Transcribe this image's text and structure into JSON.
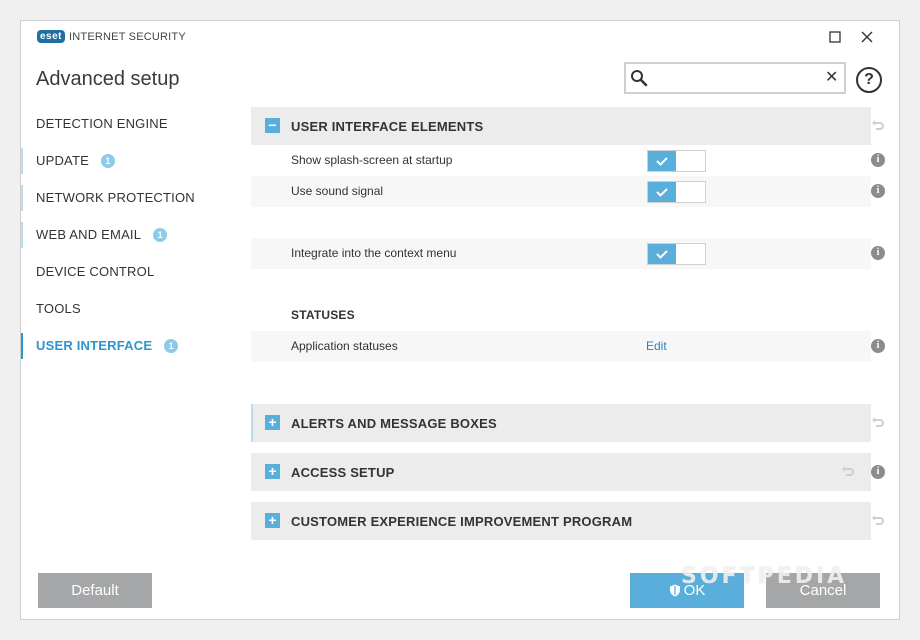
{
  "titlebar": {
    "brand": "eset",
    "product": "INTERNET SECURITY",
    "maximize_icon": "maximize-icon",
    "close_icon": "close-icon"
  },
  "page_title": "Advanced setup",
  "search": {
    "value": "",
    "placeholder": "",
    "clear_symbol": "✕"
  },
  "help_label": "?",
  "sidebar": {
    "items": [
      {
        "label": "DETECTION ENGINE",
        "badge": ""
      },
      {
        "label": "UPDATE",
        "badge": "1"
      },
      {
        "label": "NETWORK PROTECTION",
        "badge": ""
      },
      {
        "label": "WEB AND EMAIL",
        "badge": "1"
      },
      {
        "label": "DEVICE CONTROL",
        "badge": ""
      },
      {
        "label": "TOOLS",
        "badge": ""
      },
      {
        "label": "USER INTERFACE",
        "badge": "1",
        "active": true
      }
    ]
  },
  "sections": {
    "ui_elements": {
      "title": "USER INTERFACE ELEMENTS",
      "expanded": true,
      "rows": [
        {
          "label": "Show splash-screen at startup",
          "toggle": true
        },
        {
          "label": "Use sound signal",
          "toggle": true
        },
        {
          "label": "Integrate into the context menu",
          "toggle": true
        }
      ],
      "statuses_heading": "STATUSES",
      "app_statuses_label": "Application statuses",
      "edit_label": "Edit"
    },
    "alerts": {
      "title": "ALERTS AND MESSAGE BOXES",
      "expanded": false
    },
    "access": {
      "title": "ACCESS SETUP",
      "expanded": false
    },
    "ceip": {
      "title": "CUSTOMER EXPERIENCE IMPROVEMENT PROGRAM",
      "expanded": false
    }
  },
  "buttons": {
    "default": "Default",
    "ok": "OK",
    "cancel": "Cancel"
  },
  "watermark": "SOFTPEDIA",
  "colors": {
    "accent": "#5aaedb",
    "active_nav": "#2b95d0",
    "button_grey": "#a4a6a8"
  }
}
